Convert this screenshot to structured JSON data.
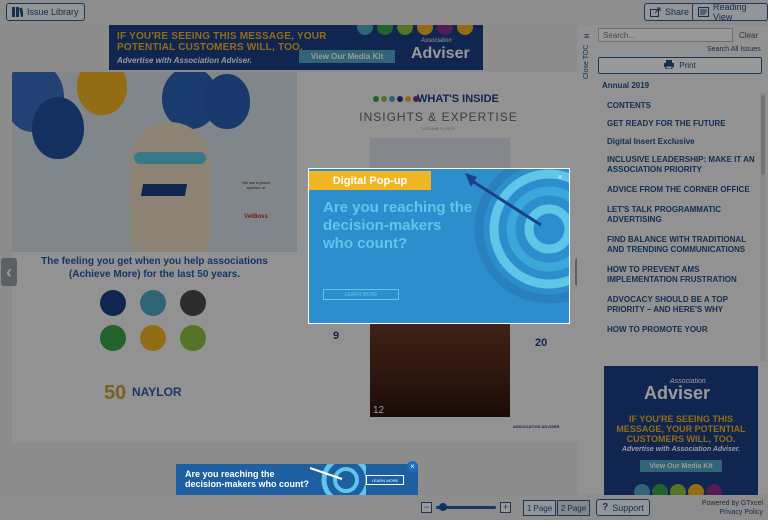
{
  "toolbar": {
    "issue_library": "Issue Library",
    "share": "Share",
    "reading_view": "Reading View"
  },
  "ad_top": {
    "line1": "IF YOU'RE SEEING THIS MESSAGE, YOUR",
    "line2": "POTENTIAL CUSTOMERS WILL, TOO.",
    "line3": "Advertise with Association Adviser.",
    "button": "View Our Media Kit",
    "brand_small": "Association",
    "brand_big": "Adviser"
  },
  "left_page": {
    "tagline1": "The feeling you get when you help associations",
    "tagline2": "(Achieve More) for the last 50 years.",
    "vet_note": "We are a proud sponsor of",
    "vet_brand": "VetBoss",
    "fifty": "50",
    "naylor": "NAYLOR"
  },
  "right_page": {
    "whats_inside": "WHAT'S INSIDE",
    "insights": "INSIGHTS & EXPERTISE",
    "volume": "VOLUME 9 | 2019",
    "num9": "9",
    "num20": "20",
    "page12": "12",
    "footer": "ASSOCIATION ADVISER"
  },
  "popup": {
    "title": "Digital Pop-up",
    "headline": "Are you reaching the decision-makers who count?",
    "learn_more": "LEARN MORE",
    "close": "×"
  },
  "ad_bottom": {
    "text1": "Are you reaching the",
    "text2": "decision-makers who count?",
    "learn_more": "LEARN MORE",
    "close": "×"
  },
  "bottombar": {
    "zoom_minus": "−",
    "zoom_plus": "+",
    "zoom_level": 0.05,
    "one_page": "1 Page",
    "two_page": "2 Page",
    "support": "Support",
    "powered": "Powered by GTxcel",
    "privacy": "Privacy Policy"
  },
  "sidebar": {
    "close_toc": "Close TOC",
    "search_placeholder": "Search...",
    "clear": "Clear",
    "search_all": "Search All Issues",
    "print": "Print",
    "issue": "Annual 2019",
    "toc": [
      "CONTENTS",
      "GET READY FOR THE FUTURE",
      "Digital Insert Exclusive",
      "INCLUSIVE LEADERSHIP: MAKE IT AN ASSOCIATION PRIORITY",
      "ADVICE FROM THE CORNER OFFICE",
      "LET'S TALK PROGRAMMATIC ADVERTISING",
      "FIND BALANCE WITH TRADITIONAL AND TRENDING COMMUNICATIONS",
      "HOW TO PREVENT AMS IMPLEMENTATION FRUSTRATION",
      "ADVOCACY SHOULD BE A TOP PRIORITY – AND HERE'S WHY",
      "HOW TO PROMOTE YOUR"
    ],
    "ad": {
      "brand_small": "Association",
      "brand_big": "Adviser",
      "message": "IF YOU'RE SEEING THIS MESSAGE, YOUR POTENTIAL CUSTOMERS WILL, TOO.",
      "small": "Advertise with Association Adviser.",
      "button": "View Our Media Kit"
    }
  },
  "colors": {
    "accent": "#1f4f86",
    "brand_navy": "#1c3f86",
    "brand_gold": "#f3b623",
    "popup_blue": "#2d8ecd"
  }
}
